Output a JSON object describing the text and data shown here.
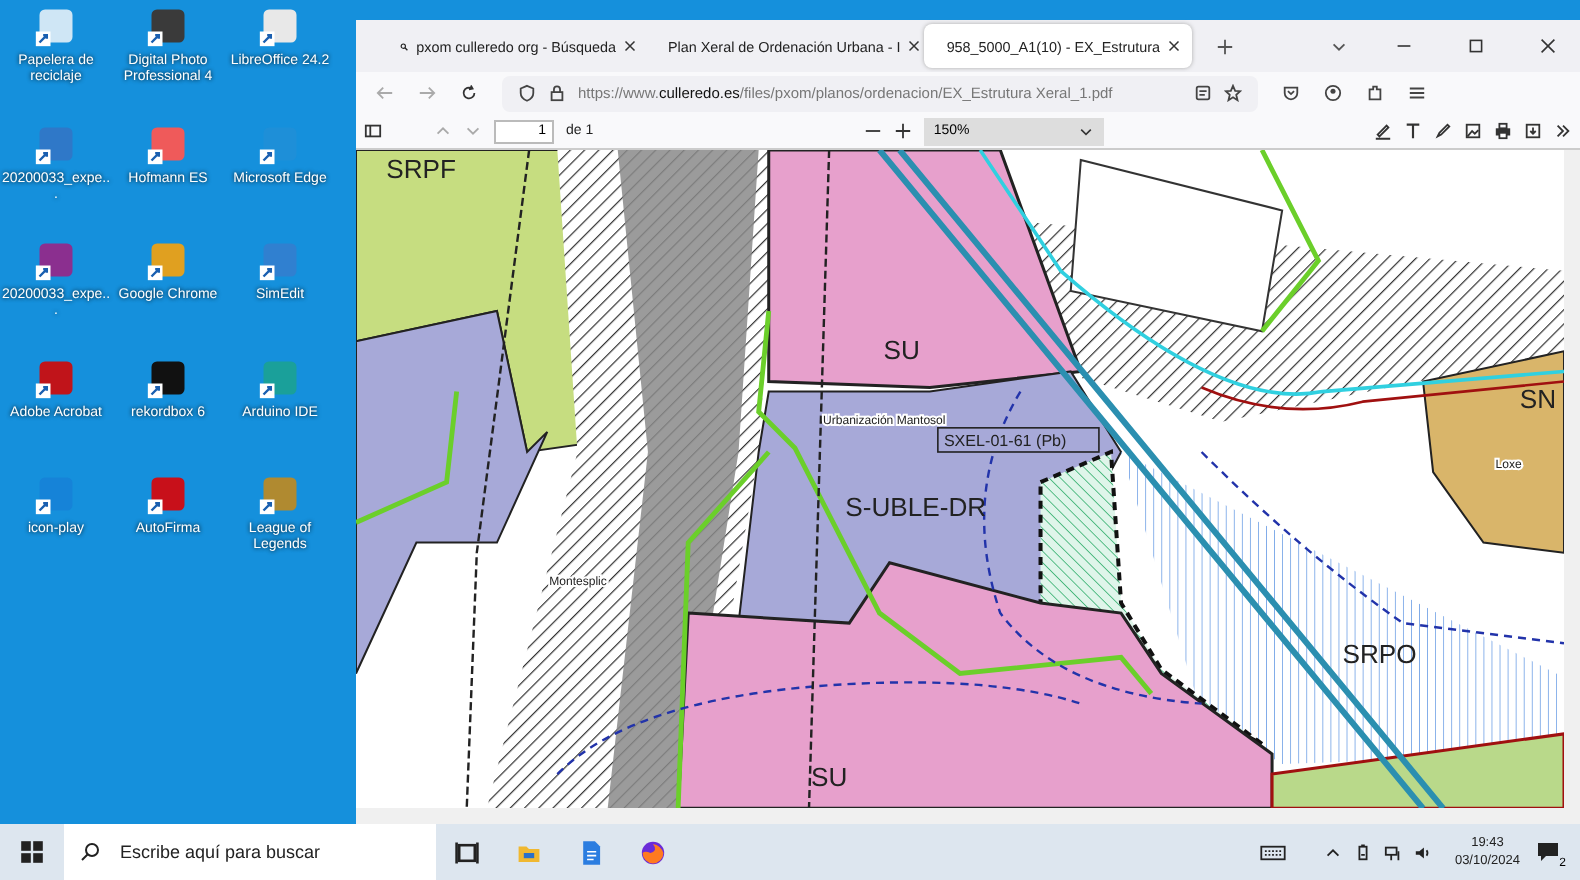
{
  "desktop_icons": [
    {
      "label": "Papelera de reciclaje"
    },
    {
      "label": "Digital Photo Professional 4"
    },
    {
      "label": "LibreOffice 24.2"
    },
    {
      "label": "20200033_expe..."
    },
    {
      "label": "Hofmann ES"
    },
    {
      "label": "Microsoft Edge"
    },
    {
      "label": "20200033_expe..."
    },
    {
      "label": "Google Chrome"
    },
    {
      "label": "SimEdit"
    },
    {
      "label": "Adobe Acrobat"
    },
    {
      "label": "rekordbox 6"
    },
    {
      "label": "Arduino IDE"
    },
    {
      "label": "icon-play"
    },
    {
      "label": "AutoFirma"
    },
    {
      "label": "League of Legends"
    }
  ],
  "browser": {
    "tabs": [
      {
        "label": "pxom culleredo org - Búsqueda",
        "selected": false
      },
      {
        "label": "Plan Xeral de Ordenación Urbana - I",
        "selected": false
      },
      {
        "label": "958_5000_A1(10) - EX_Estrutura",
        "selected": true
      }
    ],
    "url": {
      "prefix": "https://www.",
      "domain": "culleredo.es",
      "path": "/files/pxom/planos/ordenacion/EX_Estrutura Xeral_1.pdf"
    },
    "pdf_toolbar": {
      "page": "1",
      "page_total": "de 1",
      "zoom": "150%"
    },
    "map_labels": [
      {
        "text": "SRPF",
        "kind": "zone"
      },
      {
        "text": "SU",
        "kind": "zone"
      },
      {
        "text": "Urbanización Mantosol",
        "kind": "place"
      },
      {
        "text": "SXEL-01-61 (Pb)",
        "kind": "boxed"
      },
      {
        "text": "S-UBLE-DR",
        "kind": "zone"
      },
      {
        "text": "Montesplic",
        "kind": "place"
      },
      {
        "text": "SRPO",
        "kind": "zone"
      },
      {
        "text": "SU",
        "kind": "zone"
      },
      {
        "text": "SN",
        "kind": "zone"
      },
      {
        "text": "Loxe",
        "kind": "place"
      }
    ]
  },
  "taskbar": {
    "search_placeholder": "Escribe aquí para buscar",
    "time": "19:43",
    "date": "03/10/2024",
    "notifications": "2"
  }
}
